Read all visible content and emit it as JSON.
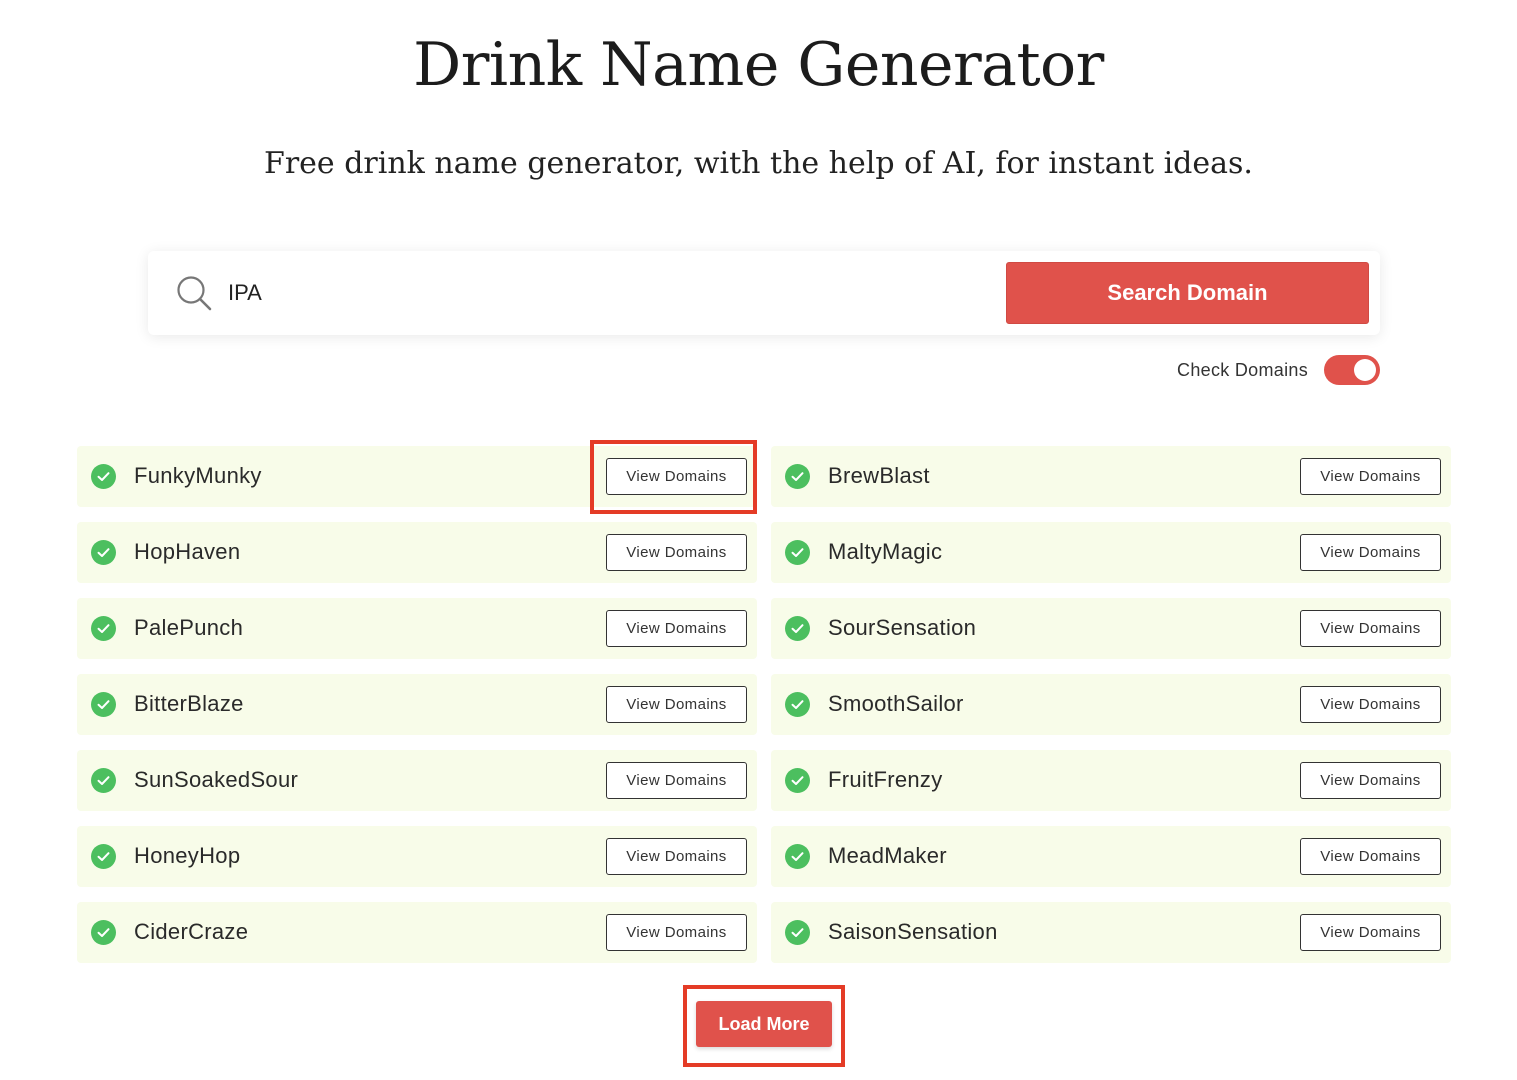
{
  "header": {
    "title": "Drink Name Generator",
    "subtitle": "Free drink name generator, with the help of AI, for instant ideas."
  },
  "search": {
    "value": "IPA",
    "button_label": "Search Domain"
  },
  "check_domains": {
    "label": "Check Domains",
    "enabled": true
  },
  "colors": {
    "accent": "#e0524b",
    "card_bg": "#f8fce9",
    "check_green": "#4cbf5f",
    "highlight": "#e43b26"
  },
  "results": [
    {
      "name": "FunkyMunky",
      "button": "View Domains",
      "available": true
    },
    {
      "name": "BrewBlast",
      "button": "View Domains",
      "available": true
    },
    {
      "name": "HopHaven",
      "button": "View Domains",
      "available": true
    },
    {
      "name": "MaltyMagic",
      "button": "View Domains",
      "available": true
    },
    {
      "name": "PalePunch",
      "button": "View Domains",
      "available": true
    },
    {
      "name": "SourSensation",
      "button": "View Domains",
      "available": true
    },
    {
      "name": "BitterBlaze",
      "button": "View Domains",
      "available": true
    },
    {
      "name": "SmoothSailor",
      "button": "View Domains",
      "available": true
    },
    {
      "name": "SunSoakedSour",
      "button": "View Domains",
      "available": true
    },
    {
      "name": "FruitFrenzy",
      "button": "View Domains",
      "available": true
    },
    {
      "name": "HoneyHop",
      "button": "View Domains",
      "available": true
    },
    {
      "name": "MeadMaker",
      "button": "View Domains",
      "available": true
    },
    {
      "name": "CiderCraze",
      "button": "View Domains",
      "available": true
    },
    {
      "name": "SaisonSensation",
      "button": "View Domains",
      "available": true
    }
  ],
  "load_more_label": "Load More"
}
